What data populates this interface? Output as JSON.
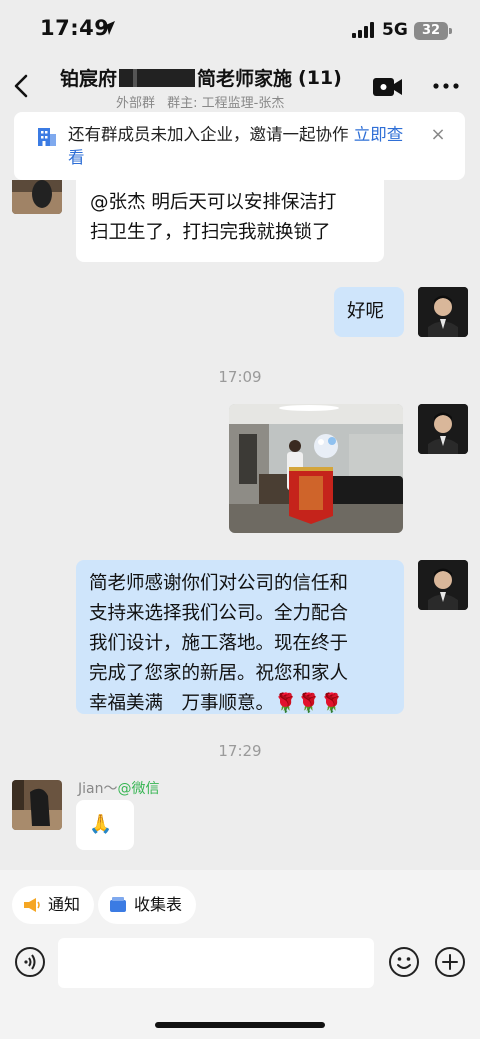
{
  "status_bar": {
    "time": "17:49",
    "network": "5G",
    "battery": "32"
  },
  "header": {
    "title_left": "铂宸府",
    "title_right": "简老师家施",
    "member_count": "(11)",
    "subtitle_tag": "外部群",
    "subtitle_owner": "群主: 工程监理-张杰"
  },
  "banner": {
    "text": "还有群成员未加入企业，邀请一起协作 ",
    "link": "立即查看",
    "close": "×"
  },
  "messages": {
    "msg1_line1": "@张杰 明后天可以安排保洁打",
    "msg1_line2": "扫卫生了，打扫完我就换锁了",
    "msg2": "好呢",
    "time1": "17:09",
    "msg3_lines": [
      "简老师感谢你们对公司的信任和",
      "支持来选择我们公司。全力配合",
      "我们设计，施工落地。现在终于",
      "完成了您家的新居。祝您和家人",
      "幸福美满　万事顺意。🌹🌹🌹"
    ],
    "time2": "17:29",
    "sender_name": "Jian～",
    "sender_source": "@微信",
    "msg4": "🙏"
  },
  "quick_bar": {
    "notice_label": "通知",
    "form_label": "收集表"
  },
  "input": {
    "placeholder": ""
  },
  "colors": {
    "outgoing_bubble": "#cfe5fb",
    "link_blue": "#2f6fd6",
    "wechat_green": "#36b552"
  }
}
